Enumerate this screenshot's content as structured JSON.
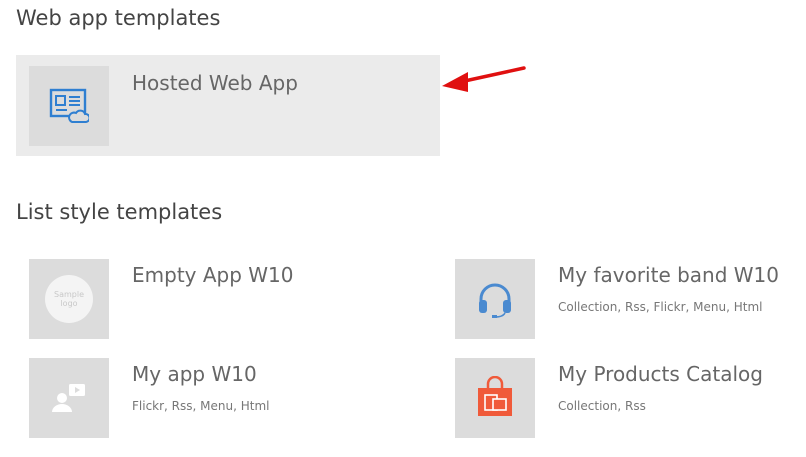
{
  "sections": {
    "web_title": "Web app templates",
    "list_title": "List style templates"
  },
  "web_templates": [
    {
      "title": "Hosted Web App",
      "icon": "hosted-web-app-icon"
    }
  ],
  "list_templates": [
    {
      "title": "Empty App W10",
      "subtitle": "",
      "icon": "sample-logo-icon",
      "logo_text": "Sample logo"
    },
    {
      "title": "My favorite band W10",
      "subtitle": "Collection, Rss, Flickr, Menu, Html",
      "icon": "headphones-icon"
    },
    {
      "title": "My app W10",
      "subtitle": "Flickr, Rss, Menu, Html",
      "icon": "user-video-icon"
    },
    {
      "title": "My Products Catalog",
      "subtitle": "Collection, Rss",
      "icon": "shopping-bag-icon"
    }
  ],
  "colors": {
    "selected_bg": "#ebebeb",
    "thumb_bg": "#dcdcdc",
    "accent_blue": "#2f7fd1",
    "band_blue": "#4a8ad0",
    "catalog_red": "#f05a3a",
    "arrow_red": "#e01010"
  }
}
